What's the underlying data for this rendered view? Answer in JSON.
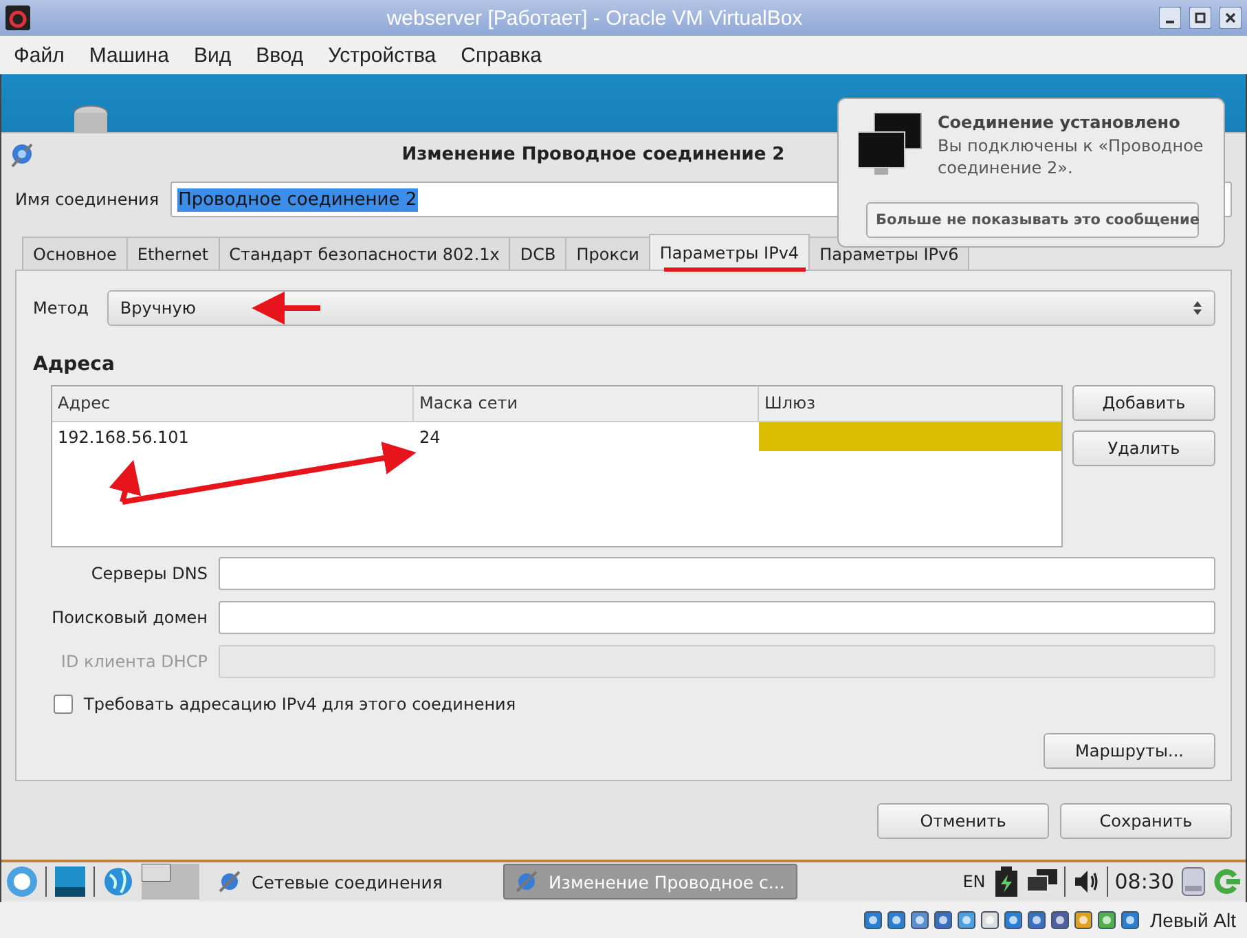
{
  "window": {
    "title": "webserver [Работает] - Oracle VM VirtualBox"
  },
  "menu": [
    "Файл",
    "Машина",
    "Вид",
    "Ввод",
    "Устройства",
    "Справка"
  ],
  "dialog": {
    "title": "Изменение Проводное соединение 2",
    "name_label": "Имя соединения",
    "name_value": "Проводное соединение 2",
    "tabs": [
      {
        "label": "Основное",
        "selected": false
      },
      {
        "label": "Ethernet",
        "selected": false
      },
      {
        "label": "Стандарт безопасности 802.1x",
        "selected": false
      },
      {
        "label": "DCB",
        "selected": false
      },
      {
        "label": "Прокси",
        "selected": false
      },
      {
        "label": "Параметры IPv4",
        "selected": true
      },
      {
        "label": "Параметры IPv6",
        "selected": false
      }
    ],
    "method_label": "Метод",
    "method_value": "Вручную",
    "addresses_heading": "Адреса",
    "columns": [
      "Адрес",
      "Маска сети",
      "Шлюз"
    ],
    "rows": [
      {
        "cells": [
          {
            "text": "192.168.56.101",
            "editing": false
          },
          {
            "text": "24",
            "editing": false
          },
          {
            "text": "",
            "editing": true
          }
        ]
      }
    ],
    "table_buttons": [
      "Добавить",
      "Удалить"
    ],
    "fields": [
      {
        "label": "Серверы DNS",
        "disabled": false
      },
      {
        "label": "Поисковый домен",
        "disabled": false
      },
      {
        "label": "ID клиента DHCP",
        "disabled": true
      }
    ],
    "require_ipv4": {
      "label": "Требовать адресацию IPv4 для этого соединения",
      "checked": false
    },
    "routes_button": "Маршруты...",
    "buttons": [
      "Отменить",
      "Сохранить"
    ]
  },
  "notification": {
    "title": "Соединение установлено",
    "body": "Вы подключены к «Проводное соединение 2».",
    "button": "Больше не показывать это сообщение"
  },
  "taskbar": {
    "tasks": [
      {
        "label": "Сетевые соединения",
        "selected": false
      },
      {
        "label": "Изменение Проводное с...",
        "selected": true
      }
    ],
    "layout": "EN",
    "clock": "08:30"
  },
  "status_bar": {
    "host_key": "Левый Alt"
  }
}
